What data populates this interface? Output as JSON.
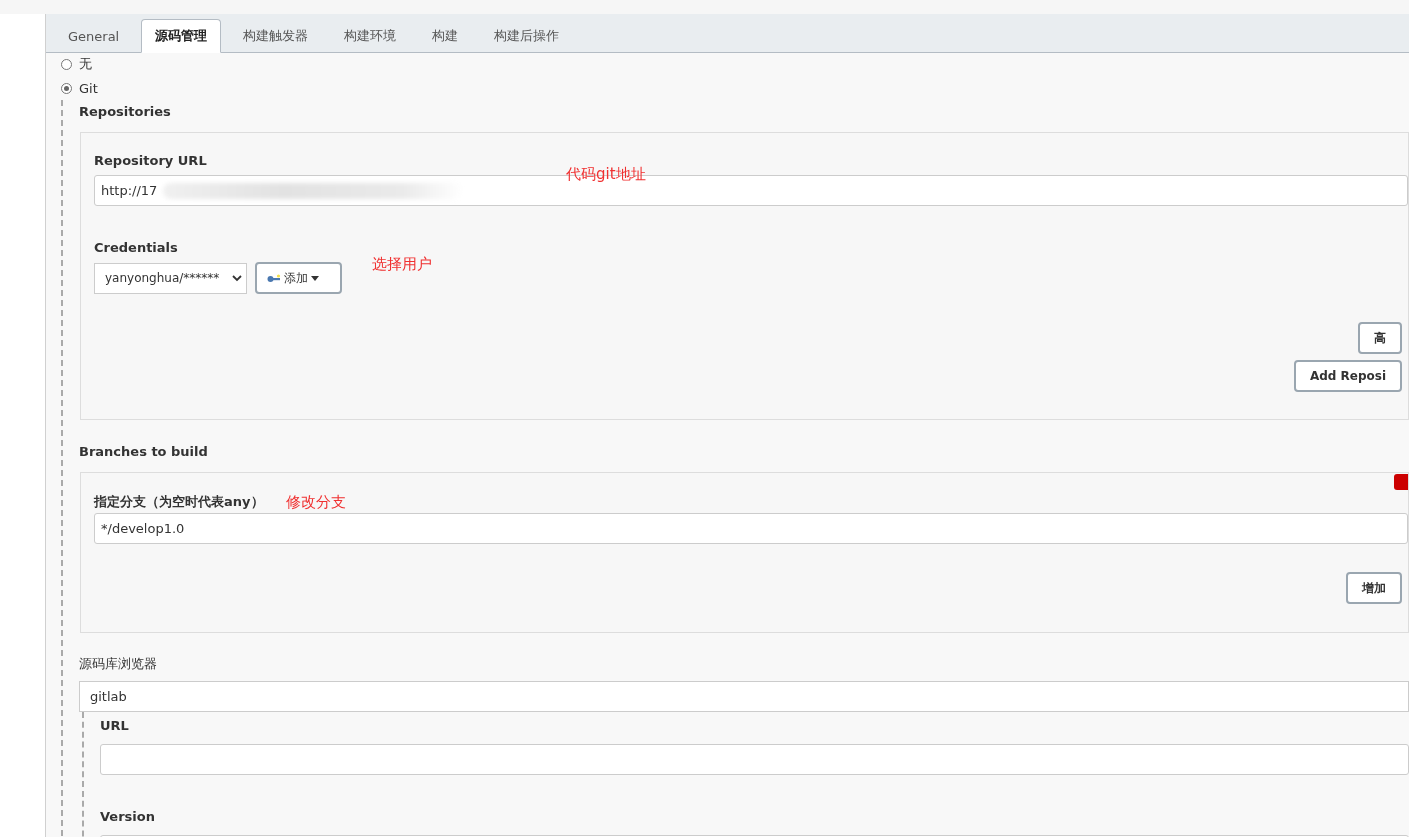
{
  "tabs": [
    {
      "label": "General",
      "selected": false
    },
    {
      "label": "源码管理",
      "selected": true
    },
    {
      "label": "构建触发器",
      "selected": false
    },
    {
      "label": "构建环境",
      "selected": false
    },
    {
      "label": "构建",
      "selected": false
    },
    {
      "label": "构建后操作",
      "selected": false
    }
  ],
  "scm_options": [
    {
      "label": "无",
      "selected": false
    },
    {
      "label": "Git",
      "selected": true
    }
  ],
  "repositories": {
    "heading": "Repositories",
    "url_label": "Repository URL",
    "url_value": "http://17",
    "credentials_label": "Credentials",
    "credentials_value": "yanyonghua/******",
    "add_button": "添加",
    "advanced_button": "高",
    "add_repository_button": "Add Reposi"
  },
  "branches": {
    "heading": "Branches to build",
    "branch_label": "指定分支（为空时代表any）",
    "branch_value": "*/develop1.0",
    "add_button": "增加"
  },
  "browser": {
    "label": "源码库浏览器",
    "value": "gitlab",
    "url_label": "URL",
    "version_label": "Version"
  },
  "annotations": [
    {
      "text": "代码git地址"
    },
    {
      "text": "选择用户"
    },
    {
      "text": "修改分支"
    }
  ]
}
